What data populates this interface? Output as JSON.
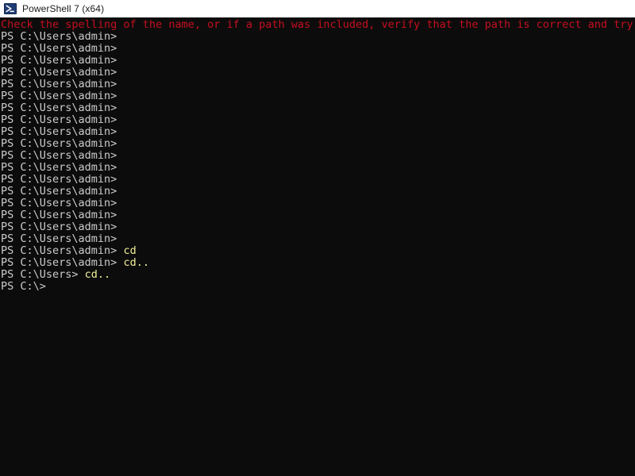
{
  "window": {
    "title": "PowerShell 7 (x64)",
    "icon": "powershell-icon",
    "titlebar_bg": "#ffffff",
    "titlebar_fg": "#1a1a1a"
  },
  "terminal": {
    "background": "#0c0c0c",
    "foreground": "#cccccc",
    "error_color": "#c50f1f",
    "command_color": "#f3f09a",
    "prompt_text": "PS C:\\Users\\admin>",
    "lines": [
      {
        "kind": "error",
        "text": "Check the spelling of the name, or if a path was included, verify that the path is correct and try"
      },
      {
        "kind": "prompt",
        "text": "PS C:\\Users\\admin>",
        "command": ""
      },
      {
        "kind": "prompt",
        "text": "PS C:\\Users\\admin>",
        "command": ""
      },
      {
        "kind": "prompt",
        "text": "PS C:\\Users\\admin>",
        "command": ""
      },
      {
        "kind": "prompt",
        "text": "PS C:\\Users\\admin>",
        "command": ""
      },
      {
        "kind": "prompt",
        "text": "PS C:\\Users\\admin>",
        "command": ""
      },
      {
        "kind": "prompt",
        "text": "PS C:\\Users\\admin>",
        "command": ""
      },
      {
        "kind": "prompt",
        "text": "PS C:\\Users\\admin>",
        "command": ""
      },
      {
        "kind": "prompt",
        "text": "PS C:\\Users\\admin>",
        "command": ""
      },
      {
        "kind": "prompt",
        "text": "PS C:\\Users\\admin>",
        "command": ""
      },
      {
        "kind": "prompt",
        "text": "PS C:\\Users\\admin>",
        "command": ""
      },
      {
        "kind": "prompt",
        "text": "PS C:\\Users\\admin>",
        "command": ""
      },
      {
        "kind": "prompt",
        "text": "PS C:\\Users\\admin>",
        "command": ""
      },
      {
        "kind": "prompt",
        "text": "PS C:\\Users\\admin>",
        "command": ""
      },
      {
        "kind": "prompt",
        "text": "PS C:\\Users\\admin>",
        "command": ""
      },
      {
        "kind": "prompt",
        "text": "PS C:\\Users\\admin>",
        "command": ""
      },
      {
        "kind": "prompt",
        "text": "PS C:\\Users\\admin>",
        "command": ""
      },
      {
        "kind": "prompt",
        "text": "PS C:\\Users\\admin>",
        "command": ""
      },
      {
        "kind": "prompt",
        "text": "PS C:\\Users\\admin>",
        "command": ""
      },
      {
        "kind": "prompt",
        "text": "PS C:\\Users\\admin>",
        "command": " cd"
      },
      {
        "kind": "prompt",
        "text": "PS C:\\Users\\admin>",
        "command": " cd.."
      },
      {
        "kind": "prompt",
        "text": "PS C:\\Users>",
        "command": " cd.."
      },
      {
        "kind": "prompt",
        "text": "PS C:\\>",
        "command": ""
      }
    ]
  }
}
